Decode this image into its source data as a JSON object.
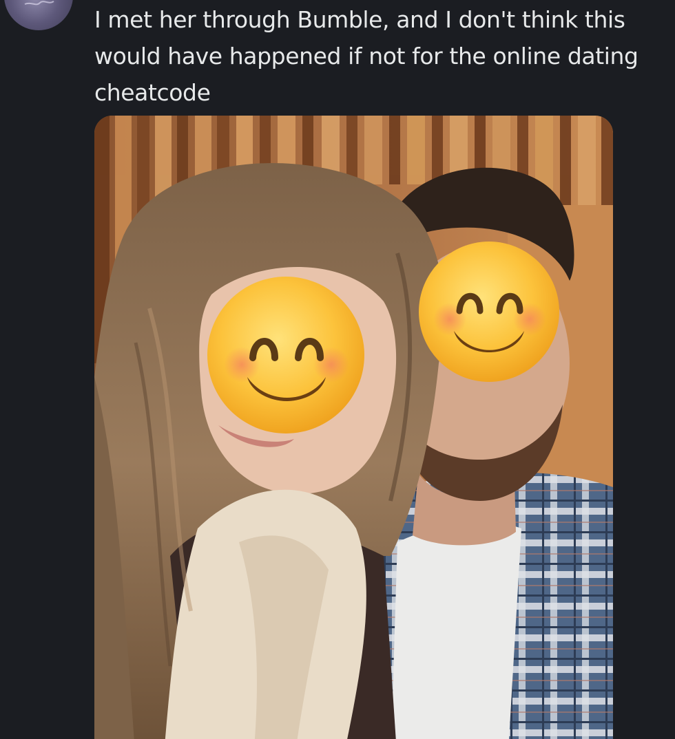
{
  "post": {
    "text": "I met her through Bumble, and I don't think this would have happened if not for the online dating cheatcode"
  },
  "media": {
    "overlay_icons": [
      "smiling-face-emoji",
      "smiling-face-emoji"
    ]
  },
  "colors": {
    "background": "#1b1d22",
    "text": "#e7e9ea"
  }
}
